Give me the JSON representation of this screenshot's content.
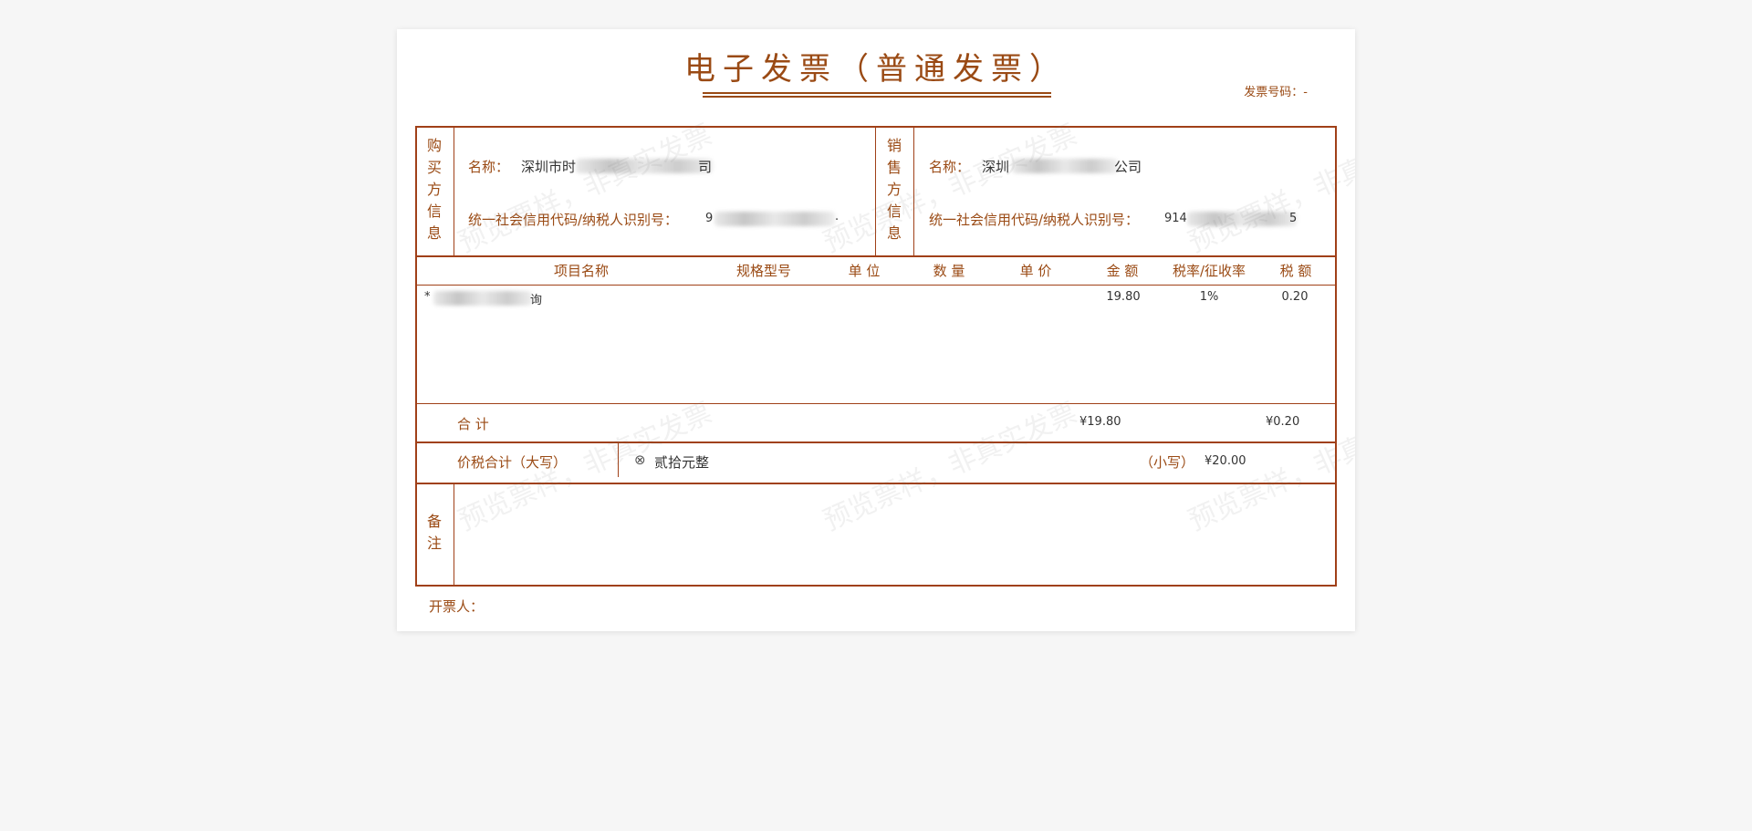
{
  "invoice": {
    "title": "电子发票（普通发票）",
    "number_label": "发票号码：-",
    "watermark": "预览票样，非真实发票",
    "buyer": {
      "section_label": [
        "购",
        "买",
        "方",
        "信",
        "息"
      ],
      "name_label": "名称：",
      "name_prefix": "深圳市时",
      "name_suffix": "司",
      "tax_label": "统一社会信用代码/纳税人识别号：",
      "tax_prefix": "9",
      "tax_suffix": "."
    },
    "seller": {
      "section_label": [
        "销",
        "售",
        "方",
        "信",
        "息"
      ],
      "name_label": "名称：",
      "name_prefix": "深圳",
      "name_suffix": "公司",
      "tax_label": "统一社会信用代码/纳税人识别号：",
      "tax_prefix": "914",
      "tax_suffix": "5"
    },
    "columns": {
      "item": "项目名称",
      "spec": "规格型号",
      "unit": "单 位",
      "qty": "数 量",
      "price": "单 价",
      "amount": "金 额",
      "rate": "税率/征收率",
      "tax": "税 额"
    },
    "items": [
      {
        "name_prefix": "*",
        "name_suffix": "询",
        "amount": "19.80",
        "rate": "1%",
        "tax": "0.20"
      }
    ],
    "totals": {
      "label": "合 计",
      "amount": "¥19.80",
      "tax": "¥0.20"
    },
    "grand_total": {
      "label": "价税合计（大写）",
      "symbol": "⊗",
      "words": "贰拾元整",
      "small_label": "（小写）",
      "small_value": "¥20.00"
    },
    "remarks": {
      "label": [
        "备",
        "注"
      ]
    },
    "issuer_label": "开票人："
  }
}
